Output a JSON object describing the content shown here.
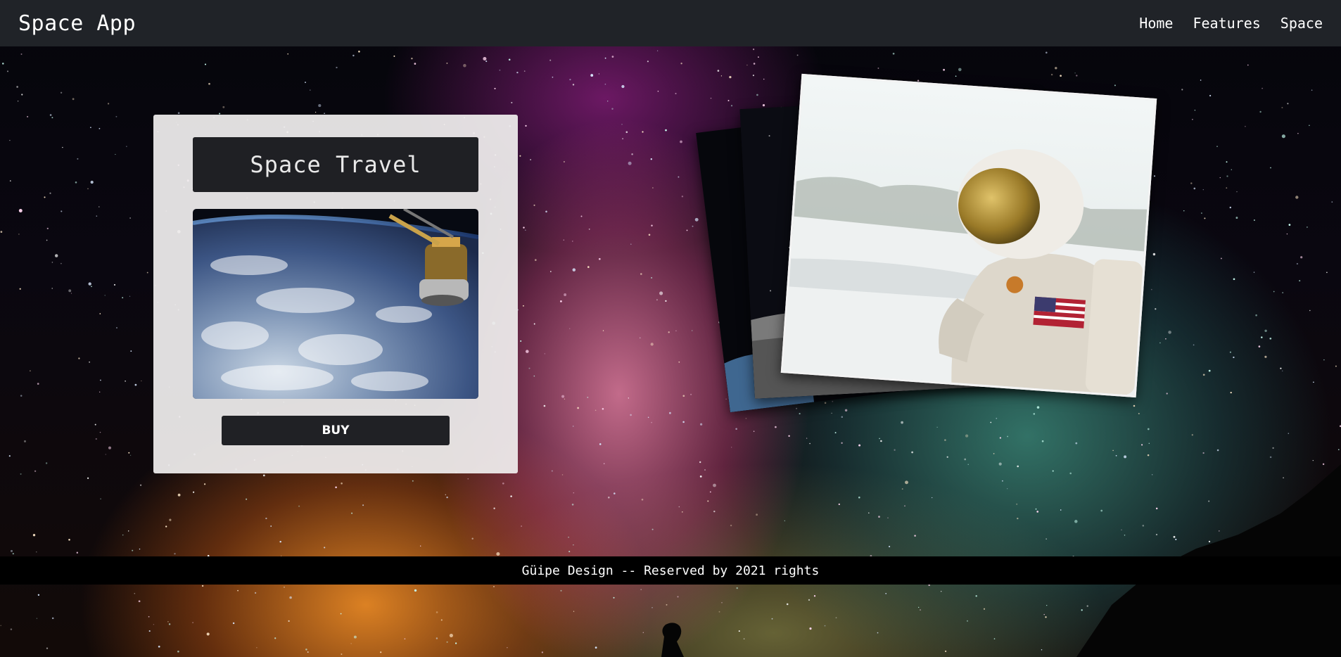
{
  "navbar": {
    "brand": "Space App",
    "links": [
      "Home",
      "Features",
      "Space"
    ],
    "background": "#202328"
  },
  "card": {
    "title": "Space Travel",
    "image_subject": "earth-from-space-station",
    "button_label": "BUY"
  },
  "gallery": {
    "images": [
      "dark-starfield-photo",
      "moon-surface-photo",
      "astronaut-in-snow-photo"
    ]
  },
  "footer": {
    "text": "Güipe Design -- Reserved by 2021 rights"
  },
  "colors": {
    "navbar": "#202328",
    "card_bg": "#efeded",
    "dark_box": "#1f2024",
    "footer_bg": "#000000"
  }
}
